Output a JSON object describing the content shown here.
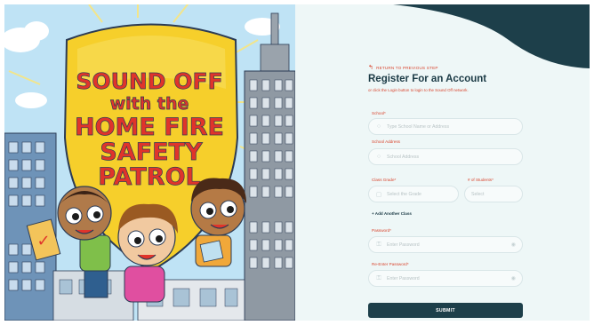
{
  "hero": {
    "title_lines": [
      "SOUND OFF",
      "with the",
      "HOME FIRE",
      "SAFETY",
      "PATROL"
    ]
  },
  "form": {
    "back_link": "RETURN TO PREVIOUS STEP",
    "heading": "Register For an Account",
    "subtext": "or click the Login button to login to the Sound Off network.",
    "school_label": "School*",
    "school_placeholder": "Type School Name or Address",
    "address_label": "School Address",
    "address_placeholder": "School Address",
    "grade_label": "Class Grade*",
    "grade_placeholder": "Select the Grade",
    "students_label": "# of Students*",
    "students_placeholder": "Select",
    "add_class": "+ Add Another Class",
    "password_label": "Password*",
    "password_placeholder": "Enter Password",
    "reenter_label": "Re-Enter Password*",
    "reenter_placeholder": "Enter Password",
    "submit_label": "SUBMIT"
  },
  "colors": {
    "accent": "#d9452e",
    "dark": "#1d3f4a",
    "panel_bg": "#eef7f7",
    "shield": "#f6cf2b"
  }
}
